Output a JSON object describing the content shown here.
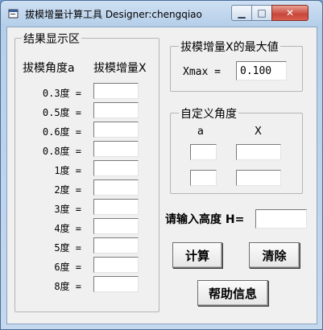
{
  "window": {
    "title": "拔模增量计算工具 Designer:chengqiao",
    "icons": {
      "app": "app-icon",
      "min": "minimize-icon",
      "max": "maximize-icon",
      "close": "close-icon"
    }
  },
  "results": {
    "group_title": "结果显示区",
    "col_angle": "拔模角度a",
    "col_increment": "拔模增量X",
    "rows": [
      {
        "angle": "0.3度 =",
        "value": ""
      },
      {
        "angle": "0.5度 =",
        "value": ""
      },
      {
        "angle": "0.6度 =",
        "value": ""
      },
      {
        "angle": "0.8度 =",
        "value": ""
      },
      {
        "angle": "1度 =",
        "value": ""
      },
      {
        "angle": "2度 =",
        "value": ""
      },
      {
        "angle": "3度 =",
        "value": ""
      },
      {
        "angle": "4度 =",
        "value": ""
      },
      {
        "angle": "5度 =",
        "value": ""
      },
      {
        "angle": "6度 =",
        "value": ""
      },
      {
        "angle": "8度 =",
        "value": ""
      }
    ]
  },
  "xmax": {
    "group_title": "拔模增量X的最大値",
    "label": "Xmax =",
    "value": "0.100"
  },
  "custom": {
    "group_title": "自定义角度",
    "col_a": "a",
    "col_x": "X",
    "rows": [
      {
        "a": "",
        "x": ""
      },
      {
        "a": "",
        "x": ""
      }
    ]
  },
  "height": {
    "label": "请输入高度 H=",
    "value": ""
  },
  "buttons": {
    "calc": "计算",
    "clear": "清除",
    "help": "帮助信息"
  }
}
